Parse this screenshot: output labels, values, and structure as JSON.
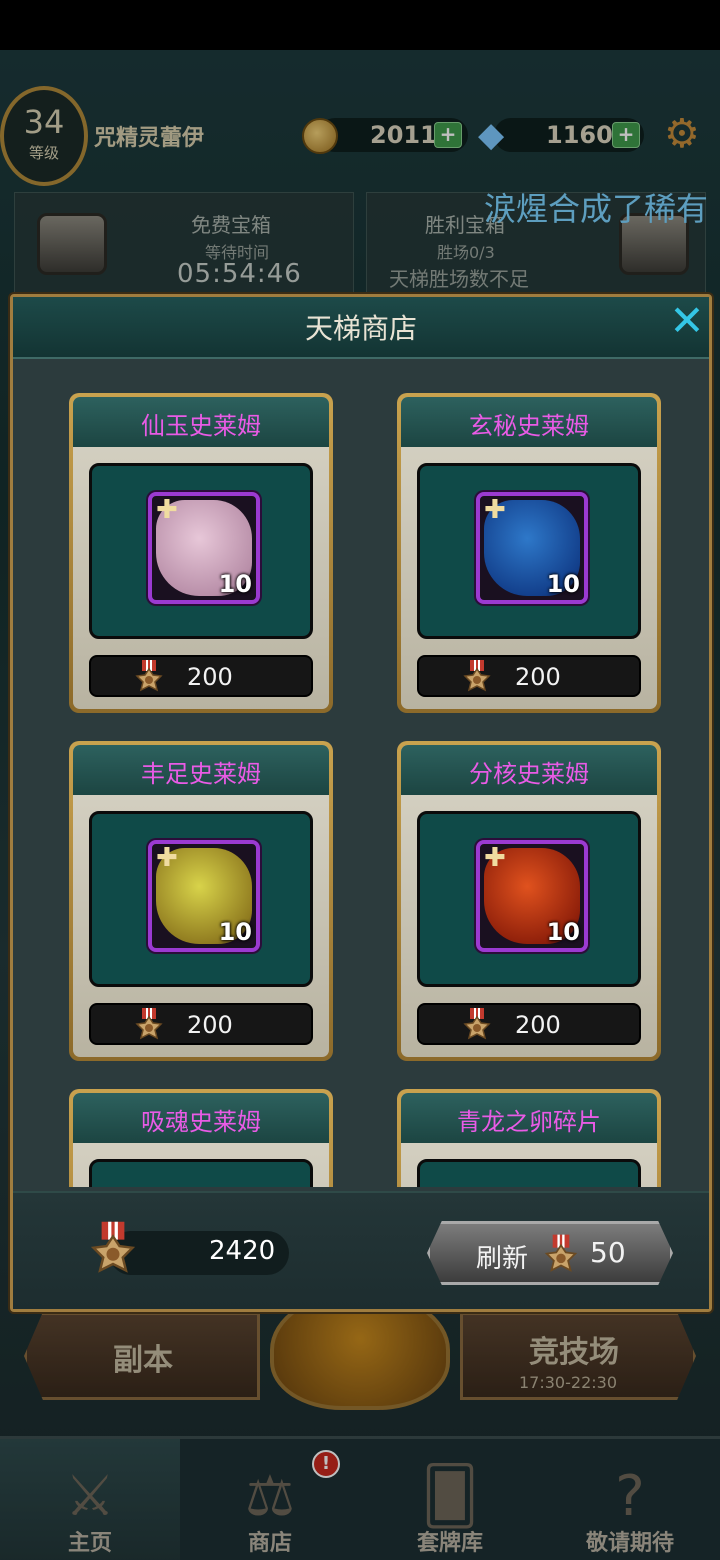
{
  "player": {
    "level": "34",
    "level_word": "等级",
    "name": "咒精灵蕾伊"
  },
  "currency": {
    "gold": "2011",
    "gems": "1160",
    "plus": "+"
  },
  "chests": {
    "free": {
      "title": "免费宝箱",
      "sub": "等待时间",
      "timer": "05:54:46"
    },
    "win": {
      "title": "胜利宝箱",
      "sub": "胜场0/3",
      "note": "天梯胜场数不足"
    }
  },
  "marquee": "涙煋合成了稀有",
  "shop": {
    "title": "天梯商店",
    "close": "✕",
    "items": [
      {
        "name": "仙玉史莱姆",
        "count": "10",
        "price": "200",
        "art_color": "#e7c7d8",
        "art_color2": "#b88ea8"
      },
      {
        "name": "玄秘史莱姆",
        "count": "10",
        "price": "200",
        "art_color": "#2e78c9",
        "art_color2": "#123e8a"
      },
      {
        "name": "丰足史莱姆",
        "count": "10",
        "price": "200",
        "art_color": "#d8d34a",
        "art_color2": "#8f7a1f"
      },
      {
        "name": "分核史莱姆",
        "count": "10",
        "price": "200",
        "art_color": "#e0521e",
        "art_color2": "#8e1f0a"
      },
      {
        "name": "吸魂史莱姆"
      },
      {
        "name": "青龙之卵碎片"
      }
    ],
    "balance": "2420",
    "refresh": {
      "label": "刷新",
      "cost": "50"
    }
  },
  "lobby": {
    "dungeon": "副本",
    "arena": "竞技场",
    "arena_time": "17:30-22:30"
  },
  "nav": [
    {
      "label": "主页"
    },
    {
      "label": "商店"
    },
    {
      "label": "套牌库"
    },
    {
      "label": "敬请期待"
    }
  ],
  "nav_badge": "!"
}
